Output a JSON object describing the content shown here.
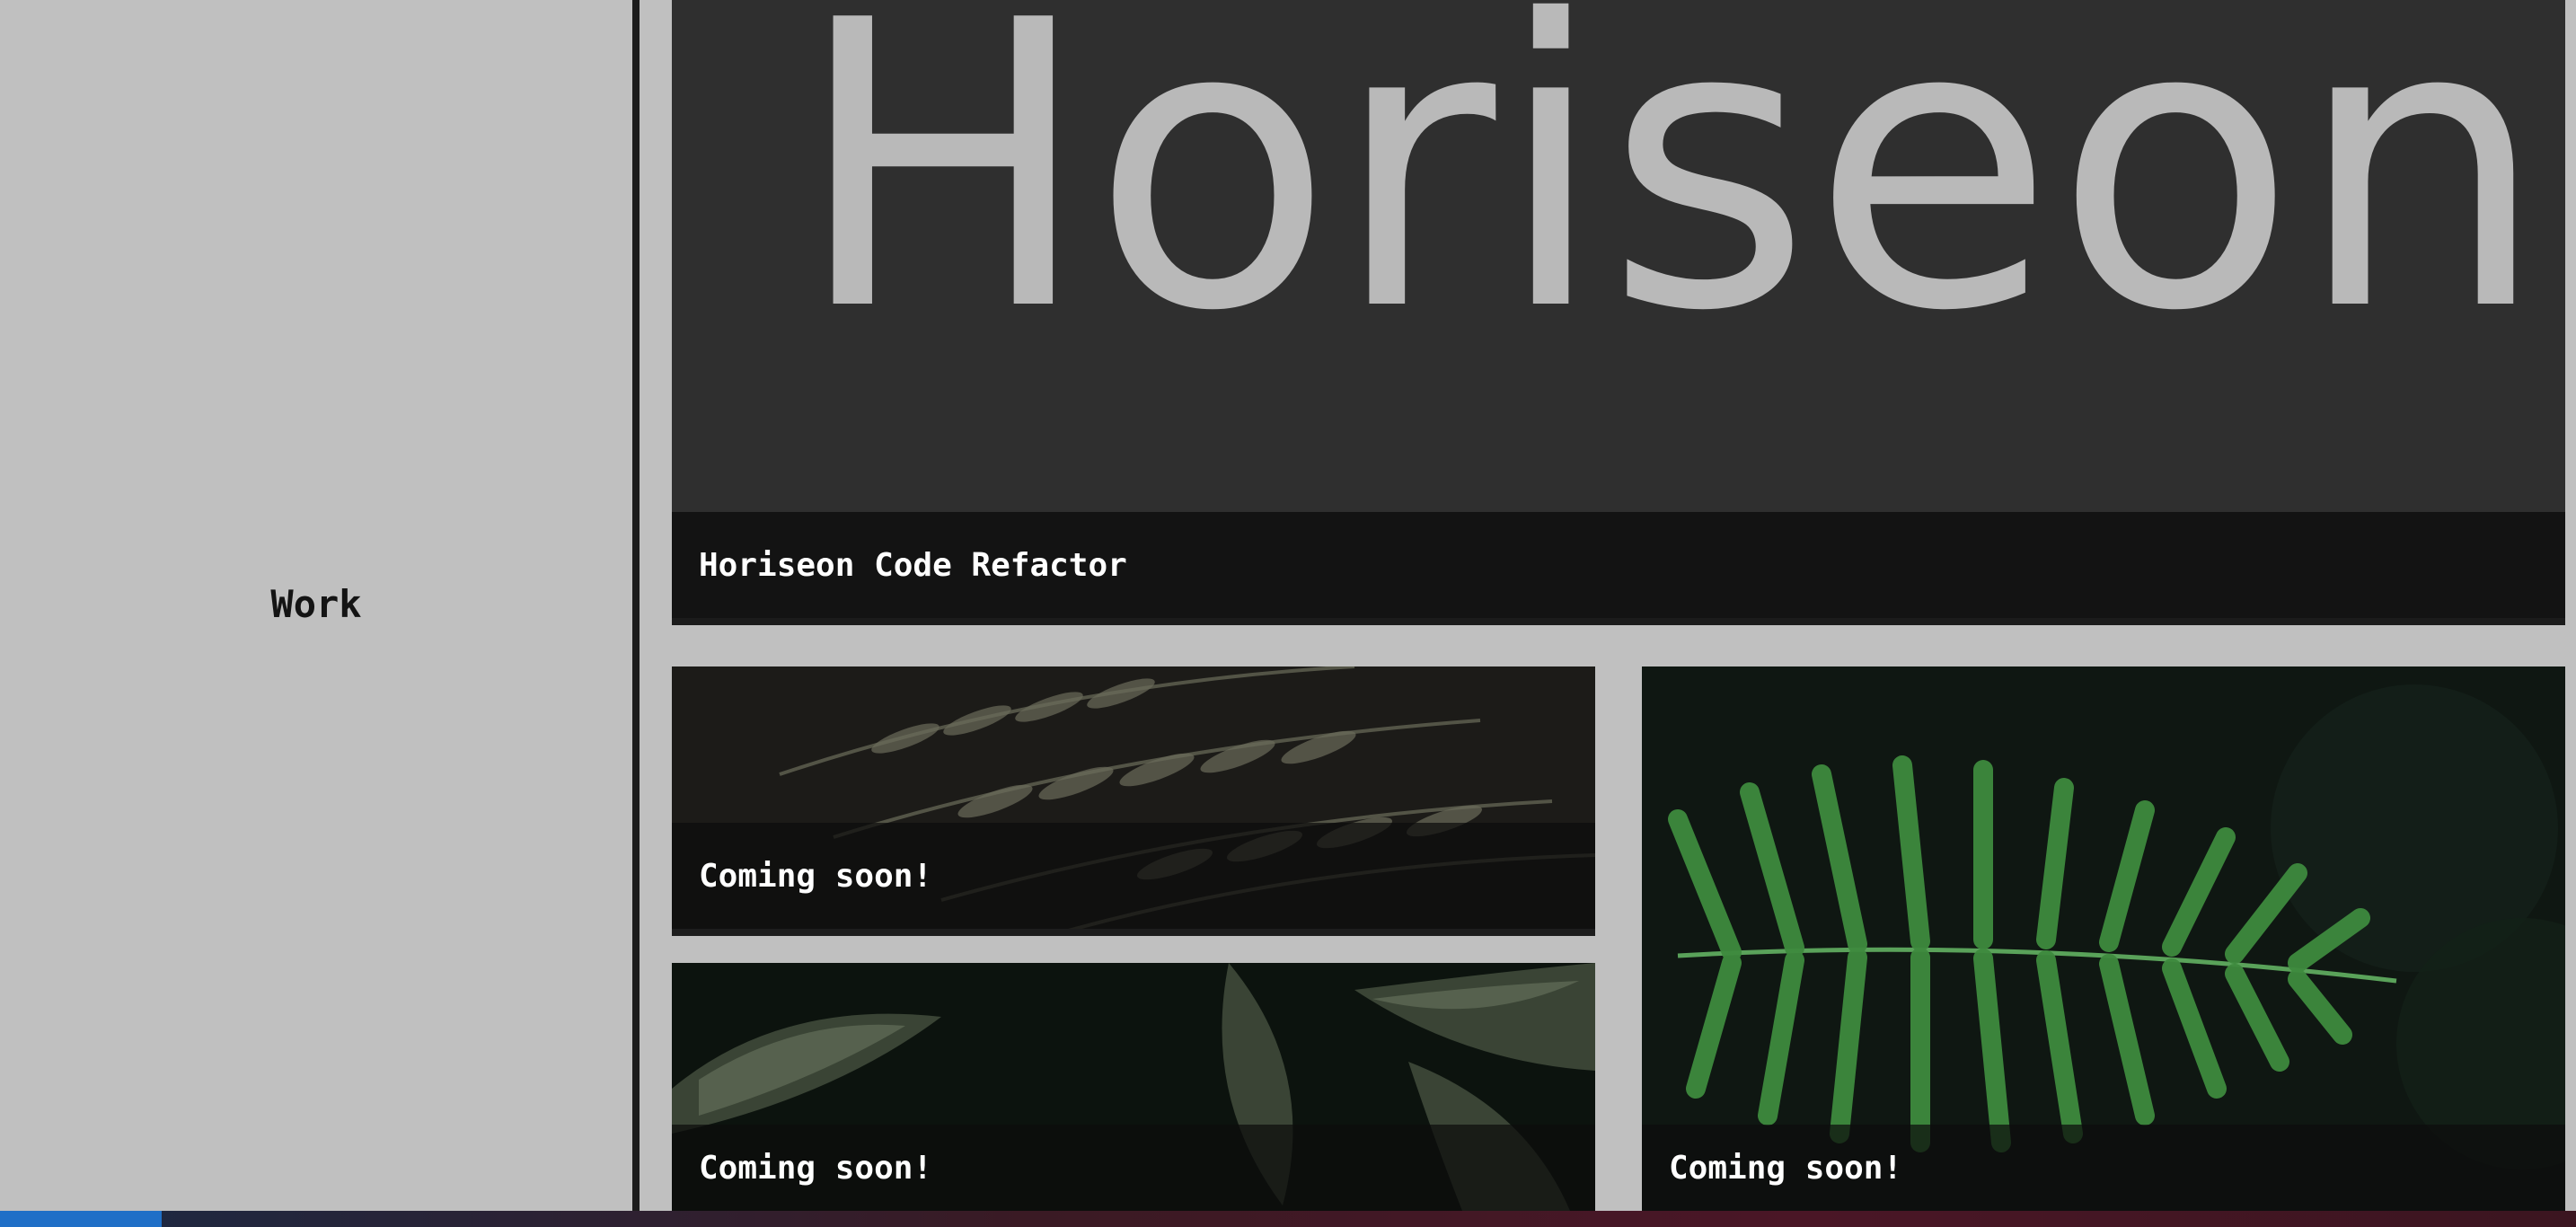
{
  "section": {
    "title": "Work"
  },
  "projects": {
    "featured": {
      "logo_text": "Horiseon",
      "label": "Horiseon Code Refactor"
    },
    "items": [
      {
        "label": "Coming soon!"
      },
      {
        "label": "Coming soon!"
      },
      {
        "label": "Coming soon!"
      }
    ]
  },
  "colors": {
    "page_background": "#c0c0c0",
    "divider": "#1c1c1c",
    "label_text": "#ffffff",
    "title_text": "#141414"
  }
}
